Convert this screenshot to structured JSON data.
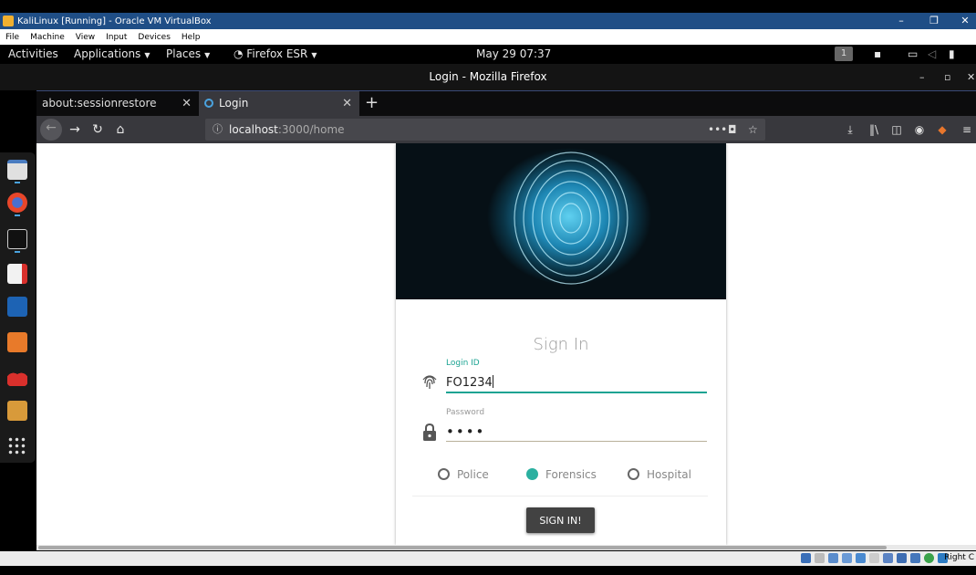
{
  "vbox": {
    "title": "KaliLinux [Running] - Oracle VM VirtualBox",
    "menu": [
      "File",
      "Machine",
      "View",
      "Input",
      "Devices",
      "Help"
    ],
    "host_key": "Right C"
  },
  "gnome": {
    "activities": "Activities",
    "applications": "Applications",
    "places": "Places",
    "firefox": "Firefox ESR",
    "datetime": "May 29  07:37",
    "workspace": "1"
  },
  "firefox": {
    "window_title": "Login - Mozilla Firefox",
    "tabs": [
      {
        "label": "about:sessionrestore"
      },
      {
        "label": "Login"
      }
    ],
    "url_host": "localhost",
    "url_path": ":3000/home"
  },
  "login": {
    "title": "Sign In",
    "login_label": "Login ID",
    "login_value": "FO1234",
    "password_label": "Password",
    "password_value": "••••",
    "roles": [
      "Police",
      "Forensics",
      "Hospital"
    ],
    "selected_role": "Forensics",
    "submit": "SIGN IN!"
  },
  "colors": {
    "accent": "#1aa392",
    "vbox_title": "#1f4e86",
    "button": "#424242"
  }
}
